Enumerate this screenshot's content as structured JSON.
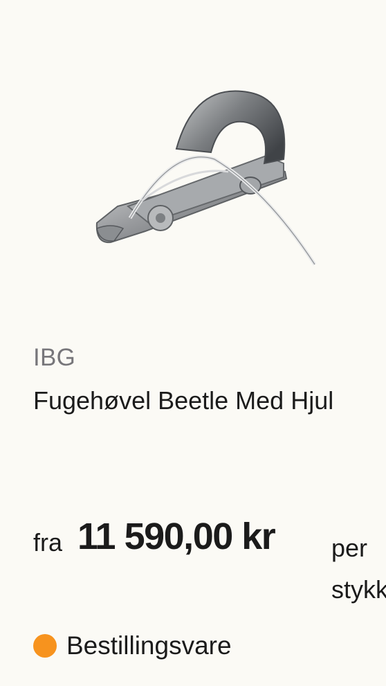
{
  "product": {
    "brand": "IBG",
    "name": "Fugehøvel Beetle Med Hjul",
    "image_alt": "Fugehøvel Beetle Med Hjul",
    "price_prefix": "fra",
    "price": "11 590,00 kr",
    "price_unit": "per stykk",
    "availability": "Bestillingsvare",
    "availability_color": "#f7931e"
  }
}
